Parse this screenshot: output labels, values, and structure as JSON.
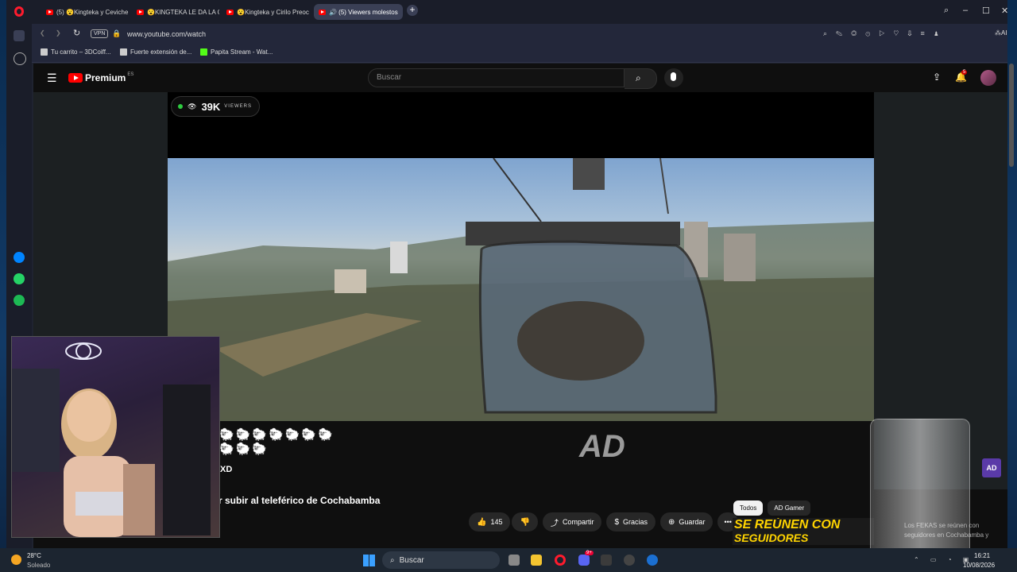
{
  "tabs": [
    {
      "label": "(5) 😮Kingteka y Ceviche"
    },
    {
      "label": "😮KINGTEKA LE DA LA C"
    },
    {
      "label": "😮Kingteka y Cirilo Preoc"
    },
    {
      "label": "🔊 (5) Viewers molestos"
    }
  ],
  "address": {
    "vpn": "VPN",
    "url": "www.youtube.com/watch",
    "ai": "AI"
  },
  "bookmarks": [
    {
      "label": "Tu carrito – 3DCoiff..."
    },
    {
      "label": "Fuerte extensión de..."
    },
    {
      "label": "Papita Stream - Wat..."
    }
  ],
  "youtube": {
    "logo": "Premium",
    "region": "ES",
    "search_placeholder": "Buscar",
    "notif_count": "5"
  },
  "stream": {
    "viewers_count": "39K",
    "viewers_label": "VIEWERS",
    "chat_text": "XD",
    "watermark": "AD",
    "title": "r subir al teleférico de Cochabamba"
  },
  "actions": {
    "likes": "145",
    "share": "Compartir",
    "thanks": "Gracias",
    "save": "Guardar"
  },
  "chips": [
    "Todos",
    "AD Gamer"
  ],
  "promo": {
    "text1": "SE REÚNEN CON",
    "text2": "SEGUIDORES",
    "desc": "Los FEKAS se reúnen con seguidores en Cochabamba y"
  },
  "taskbar": {
    "temp": "28°C",
    "weather": "Soleado",
    "search": "Buscar",
    "time": "16:21",
    "date": "10/08/2026",
    "discord_badge": "9+"
  },
  "colors": {
    "accent_red": "#ff0000",
    "opera_red": "#ff1b2d",
    "live_green": "#2ecc40"
  }
}
